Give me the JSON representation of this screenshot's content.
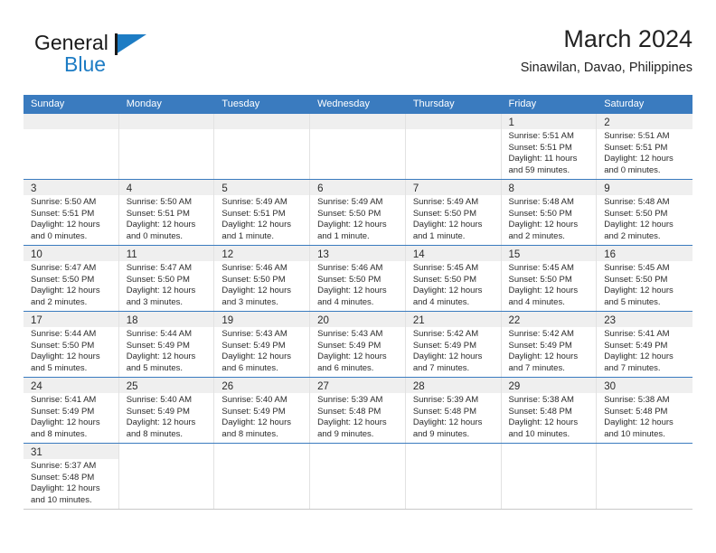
{
  "brand": {
    "name_top": "General",
    "name_bottom": "Blue",
    "accent_color": "#1d7cc4"
  },
  "header": {
    "title": "March 2024",
    "subtitle": "Sinawilan, Davao, Philippines"
  },
  "calendar": {
    "header_bg": "#3a7bbf",
    "weekday_headers": [
      "Sunday",
      "Monday",
      "Tuesday",
      "Wednesday",
      "Thursday",
      "Friday",
      "Saturday"
    ],
    "weeks": [
      [
        {
          "day": "",
          "lines": []
        },
        {
          "day": "",
          "lines": []
        },
        {
          "day": "",
          "lines": []
        },
        {
          "day": "",
          "lines": []
        },
        {
          "day": "",
          "lines": []
        },
        {
          "day": "1",
          "lines": [
            "Sunrise: 5:51 AM",
            "Sunset: 5:51 PM",
            "Daylight: 11 hours",
            "and 59 minutes."
          ]
        },
        {
          "day": "2",
          "lines": [
            "Sunrise: 5:51 AM",
            "Sunset: 5:51 PM",
            "Daylight: 12 hours",
            "and 0 minutes."
          ]
        }
      ],
      [
        {
          "day": "3",
          "lines": [
            "Sunrise: 5:50 AM",
            "Sunset: 5:51 PM",
            "Daylight: 12 hours",
            "and 0 minutes."
          ]
        },
        {
          "day": "4",
          "lines": [
            "Sunrise: 5:50 AM",
            "Sunset: 5:51 PM",
            "Daylight: 12 hours",
            "and 0 minutes."
          ]
        },
        {
          "day": "5",
          "lines": [
            "Sunrise: 5:49 AM",
            "Sunset: 5:51 PM",
            "Daylight: 12 hours",
            "and 1 minute."
          ]
        },
        {
          "day": "6",
          "lines": [
            "Sunrise: 5:49 AM",
            "Sunset: 5:50 PM",
            "Daylight: 12 hours",
            "and 1 minute."
          ]
        },
        {
          "day": "7",
          "lines": [
            "Sunrise: 5:49 AM",
            "Sunset: 5:50 PM",
            "Daylight: 12 hours",
            "and 1 minute."
          ]
        },
        {
          "day": "8",
          "lines": [
            "Sunrise: 5:48 AM",
            "Sunset: 5:50 PM",
            "Daylight: 12 hours",
            "and 2 minutes."
          ]
        },
        {
          "day": "9",
          "lines": [
            "Sunrise: 5:48 AM",
            "Sunset: 5:50 PM",
            "Daylight: 12 hours",
            "and 2 minutes."
          ]
        }
      ],
      [
        {
          "day": "10",
          "lines": [
            "Sunrise: 5:47 AM",
            "Sunset: 5:50 PM",
            "Daylight: 12 hours",
            "and 2 minutes."
          ]
        },
        {
          "day": "11",
          "lines": [
            "Sunrise: 5:47 AM",
            "Sunset: 5:50 PM",
            "Daylight: 12 hours",
            "and 3 minutes."
          ]
        },
        {
          "day": "12",
          "lines": [
            "Sunrise: 5:46 AM",
            "Sunset: 5:50 PM",
            "Daylight: 12 hours",
            "and 3 minutes."
          ]
        },
        {
          "day": "13",
          "lines": [
            "Sunrise: 5:46 AM",
            "Sunset: 5:50 PM",
            "Daylight: 12 hours",
            "and 4 minutes."
          ]
        },
        {
          "day": "14",
          "lines": [
            "Sunrise: 5:45 AM",
            "Sunset: 5:50 PM",
            "Daylight: 12 hours",
            "and 4 minutes."
          ]
        },
        {
          "day": "15",
          "lines": [
            "Sunrise: 5:45 AM",
            "Sunset: 5:50 PM",
            "Daylight: 12 hours",
            "and 4 minutes."
          ]
        },
        {
          "day": "16",
          "lines": [
            "Sunrise: 5:45 AM",
            "Sunset: 5:50 PM",
            "Daylight: 12 hours",
            "and 5 minutes."
          ]
        }
      ],
      [
        {
          "day": "17",
          "lines": [
            "Sunrise: 5:44 AM",
            "Sunset: 5:50 PM",
            "Daylight: 12 hours",
            "and 5 minutes."
          ]
        },
        {
          "day": "18",
          "lines": [
            "Sunrise: 5:44 AM",
            "Sunset: 5:49 PM",
            "Daylight: 12 hours",
            "and 5 minutes."
          ]
        },
        {
          "day": "19",
          "lines": [
            "Sunrise: 5:43 AM",
            "Sunset: 5:49 PM",
            "Daylight: 12 hours",
            "and 6 minutes."
          ]
        },
        {
          "day": "20",
          "lines": [
            "Sunrise: 5:43 AM",
            "Sunset: 5:49 PM",
            "Daylight: 12 hours",
            "and 6 minutes."
          ]
        },
        {
          "day": "21",
          "lines": [
            "Sunrise: 5:42 AM",
            "Sunset: 5:49 PM",
            "Daylight: 12 hours",
            "and 7 minutes."
          ]
        },
        {
          "day": "22",
          "lines": [
            "Sunrise: 5:42 AM",
            "Sunset: 5:49 PM",
            "Daylight: 12 hours",
            "and 7 minutes."
          ]
        },
        {
          "day": "23",
          "lines": [
            "Sunrise: 5:41 AM",
            "Sunset: 5:49 PM",
            "Daylight: 12 hours",
            "and 7 minutes."
          ]
        }
      ],
      [
        {
          "day": "24",
          "lines": [
            "Sunrise: 5:41 AM",
            "Sunset: 5:49 PM",
            "Daylight: 12 hours",
            "and 8 minutes."
          ]
        },
        {
          "day": "25",
          "lines": [
            "Sunrise: 5:40 AM",
            "Sunset: 5:49 PM",
            "Daylight: 12 hours",
            "and 8 minutes."
          ]
        },
        {
          "day": "26",
          "lines": [
            "Sunrise: 5:40 AM",
            "Sunset: 5:49 PM",
            "Daylight: 12 hours",
            "and 8 minutes."
          ]
        },
        {
          "day": "27",
          "lines": [
            "Sunrise: 5:39 AM",
            "Sunset: 5:48 PM",
            "Daylight: 12 hours",
            "and 9 minutes."
          ]
        },
        {
          "day": "28",
          "lines": [
            "Sunrise: 5:39 AM",
            "Sunset: 5:48 PM",
            "Daylight: 12 hours",
            "and 9 minutes."
          ]
        },
        {
          "day": "29",
          "lines": [
            "Sunrise: 5:38 AM",
            "Sunset: 5:48 PM",
            "Daylight: 12 hours",
            "and 10 minutes."
          ]
        },
        {
          "day": "30",
          "lines": [
            "Sunrise: 5:38 AM",
            "Sunset: 5:48 PM",
            "Daylight: 12 hours",
            "and 10 minutes."
          ]
        }
      ],
      [
        {
          "day": "31",
          "lines": [
            "Sunrise: 5:37 AM",
            "Sunset: 5:48 PM",
            "Daylight: 12 hours",
            "and 10 minutes."
          ]
        },
        {
          "day": null,
          "lines": []
        },
        {
          "day": null,
          "lines": []
        },
        {
          "day": null,
          "lines": []
        },
        {
          "day": null,
          "lines": []
        },
        {
          "day": null,
          "lines": []
        },
        {
          "day": null,
          "lines": []
        }
      ]
    ]
  }
}
